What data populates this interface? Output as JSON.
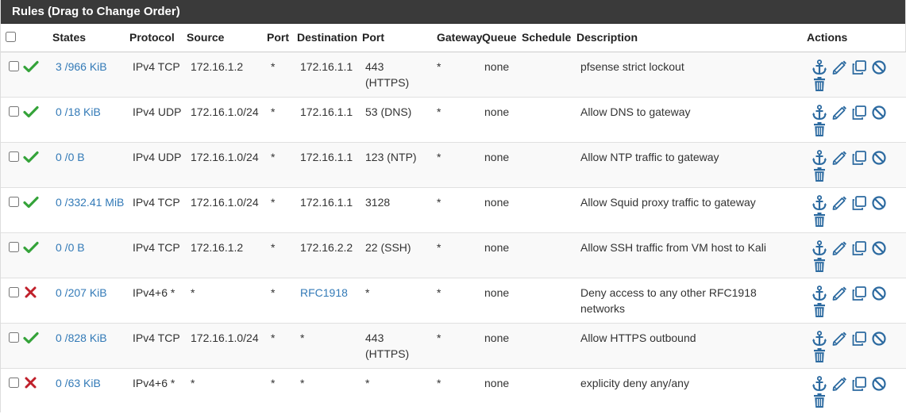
{
  "panel": {
    "title": "Rules (Drag to Change Order)"
  },
  "columns": {
    "states": "States",
    "protocol": "Protocol",
    "source": "Source",
    "source_port": "Port",
    "destination": "Destination",
    "dest_port": "Port",
    "gateway": "Gateway",
    "queue": "Queue",
    "schedule": "Schedule",
    "description": "Description",
    "actions": "Actions"
  },
  "colors": {
    "pass": "#35a33a",
    "block": "#c0202b",
    "link": "#337ab7",
    "action_icon": "#2c6aa0"
  },
  "rules": [
    {
      "status": "pass",
      "states": "3 /966 KiB",
      "protocol": "IPv4 TCP",
      "source": "172.16.1.2",
      "source_port": "*",
      "destination": "172.16.1.1",
      "dest_port": "443 (HTTPS)",
      "gateway": "*",
      "queue": "none",
      "schedule": "",
      "description": "pfsense strict lockout"
    },
    {
      "status": "pass",
      "states": "0 /18 KiB",
      "protocol": "IPv4 UDP",
      "source": "172.16.1.0/24",
      "source_port": "*",
      "destination": "172.16.1.1",
      "dest_port": "53 (DNS)",
      "gateway": "*",
      "queue": "none",
      "schedule": "",
      "description": "Allow DNS to gateway"
    },
    {
      "status": "pass",
      "states": "0 /0 B",
      "protocol": "IPv4 UDP",
      "source": "172.16.1.0/24",
      "source_port": "*",
      "destination": "172.16.1.1",
      "dest_port": "123 (NTP)",
      "gateway": "*",
      "queue": "none",
      "schedule": "",
      "description": "Allow NTP traffic to gateway"
    },
    {
      "status": "pass",
      "states": "0 /332.41 MiB",
      "protocol": "IPv4 TCP",
      "source": "172.16.1.0/24",
      "source_port": "*",
      "destination": "172.16.1.1",
      "dest_port": "3128",
      "gateway": "*",
      "queue": "none",
      "schedule": "",
      "description": "Allow Squid proxy traffic to gateway"
    },
    {
      "status": "pass",
      "states": "0 /0 B",
      "protocol": "IPv4 TCP",
      "source": "172.16.1.2",
      "source_port": "*",
      "destination": "172.16.2.2",
      "dest_port": "22 (SSH)",
      "gateway": "*",
      "queue": "none",
      "schedule": "",
      "description": "Allow SSH traffic from VM host to Kali"
    },
    {
      "status": "block",
      "states": "0 /207 KiB",
      "protocol": "IPv4+6 *",
      "source": "*",
      "source_port": "*",
      "destination": "RFC1918",
      "dest_port": "*",
      "gateway": "*",
      "queue": "none",
      "schedule": "",
      "description": "Deny access to any other RFC1918 networks",
      "destination_is_link": true
    },
    {
      "status": "pass",
      "states": "0 /828 KiB",
      "protocol": "IPv4 TCP",
      "source": "172.16.1.0/24",
      "source_port": "*",
      "destination": "*",
      "dest_port": "443 (HTTPS)",
      "gateway": "*",
      "queue": "none",
      "schedule": "",
      "description": "Allow HTTPS outbound"
    },
    {
      "status": "block",
      "states": "0 /63 KiB",
      "protocol": "IPv4+6 *",
      "source": "*",
      "source_port": "*",
      "destination": "*",
      "dest_port": "*",
      "gateway": "*",
      "queue": "none",
      "schedule": "",
      "description": "explicity deny any/any"
    }
  ],
  "icons": {
    "pass": "check-icon",
    "block": "x-icon",
    "actions": [
      "anchor-icon",
      "pencil-icon",
      "copy-icon",
      "disable-icon",
      "trash-icon"
    ]
  }
}
